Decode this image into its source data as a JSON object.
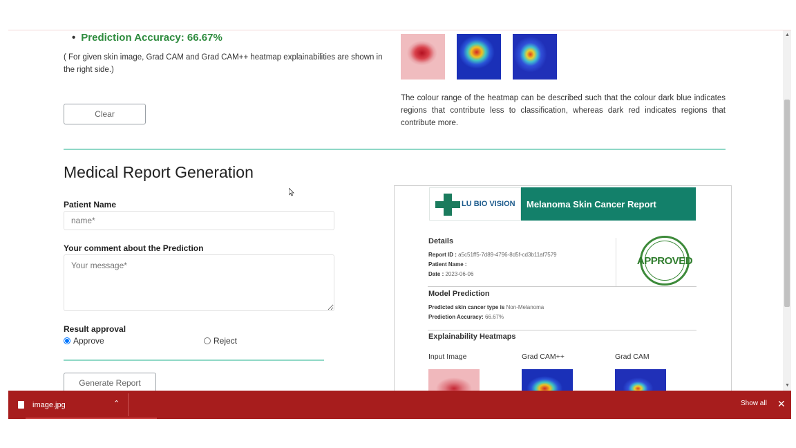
{
  "prediction": {
    "accuracy_text": "Prediction Accuracy: 66.67%",
    "note": "( For given skin image, Grad CAM and Grad CAM++ heatmap explainabilities are shown in the right side.)",
    "clear_label": "Clear",
    "heatmap_description": "The colour range of the heatmap can be described such that the colour dark blue indicates regions that contribute less to classification, whereas dark red indicates regions that contribute more."
  },
  "report_form": {
    "title": "Medical Report Generation",
    "patient_name_label": "Patient Name",
    "patient_name_placeholder": "name*",
    "comment_label": "Your comment about the Prediction",
    "comment_placeholder": "Your message*",
    "approval_label": "Result approval",
    "approve_label": "Approve",
    "reject_label": "Reject",
    "selected": "Approve",
    "generate_label": "Generate Report"
  },
  "report_preview": {
    "logo_text": "LU BIO VISION",
    "banner_title": "Melanoma Skin Cancer Report",
    "details_title": "Details",
    "report_id_label": "Report ID :",
    "report_id_value": "a5c51ff5-7d89-4796-8d5f-cd3b11af7579",
    "patient_name_label": "Patient Name :",
    "date_label": "Date :",
    "date_value": "2023-06-06",
    "seal_text": "APPROVED",
    "model_title": "Model Prediction",
    "predicted_label": "Predicted skin cancer type is",
    "predicted_value": "Non-Melanoma",
    "accuracy_label": "Prediction Accuracy:",
    "accuracy_value": "66.67%",
    "heatmaps_title": "Explainability Heatmaps",
    "col_input": "Input Image",
    "col_gradcampp": "Grad CAM++",
    "col_gradcam": "Grad CAM"
  },
  "download_bar": {
    "file_name": "image.jpg",
    "show_all": "Show all"
  },
  "colors": {
    "accent_green": "#2e8b3e",
    "divider": "#8fd8c6",
    "banner": "#13806a",
    "download_bar": "#a71d1d"
  }
}
